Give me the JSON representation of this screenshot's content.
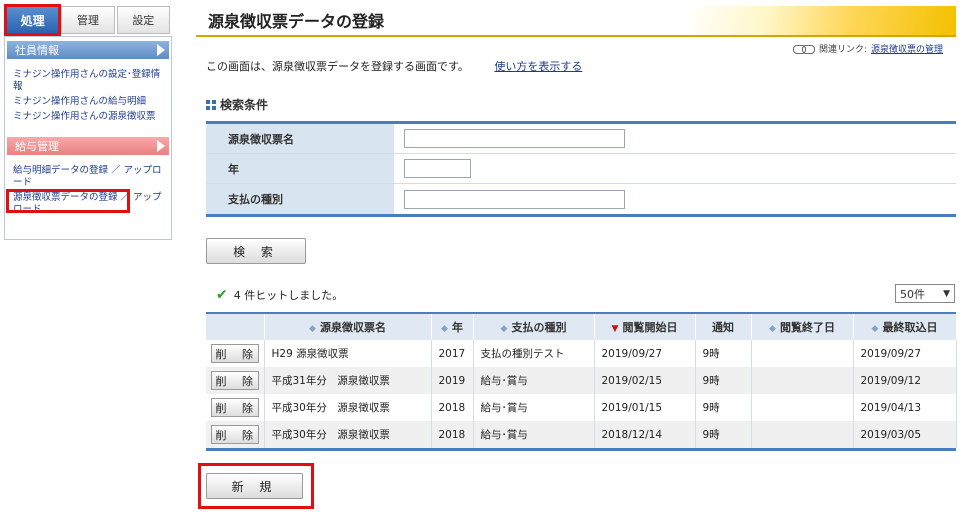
{
  "sidebar": {
    "tabs": [
      {
        "label": "処理",
        "active": true
      },
      {
        "label": "管理",
        "active": false
      },
      {
        "label": "設定",
        "active": false
      }
    ],
    "sections": [
      {
        "title": "社員情報",
        "links": [
          "ミナジン操作用さんの設定･登録情報",
          "ミナジン操作用さんの給与明細",
          "ミナジン操作用さんの源泉徴収票"
        ]
      },
      {
        "title": "給与管理",
        "links": [
          "給与明細データの登録 ／ アップロード",
          "源泉徴収票データの登録 ／ アップロード"
        ]
      }
    ]
  },
  "header": {
    "title": "源泉徴収票データの登録",
    "related_label": "関連リンク:",
    "related_link": "源泉徴収票の管理"
  },
  "intro": {
    "text": "この画面は、源泉徴収票データを登録する画面です。",
    "help_link": "使い方を表示する"
  },
  "search": {
    "section_title": "検索条件",
    "fields": [
      {
        "label": "源泉徴収票名",
        "value": ""
      },
      {
        "label": "年",
        "value": ""
      },
      {
        "label": "支払の種別",
        "value": ""
      }
    ],
    "button_label": "検 索"
  },
  "results": {
    "hits_text": "4 件ヒットしました。",
    "per_page": "50件",
    "columns": [
      "",
      "源泉徴収票名",
      "年",
      "支払の種別",
      "閲覧開始日",
      "通知",
      "閲覧終了日",
      "最終取込日"
    ],
    "delete_label": "削 除",
    "rows": [
      {
        "name": "H29 源泉徴収票",
        "year": "2017",
        "type": "支払の種別テスト",
        "start": "2019/09/27",
        "notify": "9時",
        "end": "",
        "last": "2019/09/27"
      },
      {
        "name": "平成31年分　源泉徴収票",
        "year": "2019",
        "type": "給与･賞与",
        "start": "2019/02/15",
        "notify": "9時",
        "end": "",
        "last": "2019/09/12"
      },
      {
        "name": "平成30年分　源泉徴収票",
        "year": "2018",
        "type": "給与･賞与",
        "start": "2019/01/15",
        "notify": "9時",
        "end": "",
        "last": "2019/04/13"
      },
      {
        "name": "平成30年分　源泉徴収票",
        "year": "2018",
        "type": "給与･賞与",
        "start": "2018/12/14",
        "notify": "9時",
        "end": "",
        "last": "2019/03/05"
      }
    ]
  },
  "actions": {
    "new_label": "新 規"
  },
  "colors": {
    "accent_blue": "#4a7cc0",
    "highlight_red": "#e01010",
    "header_gold": "#f3c000"
  }
}
